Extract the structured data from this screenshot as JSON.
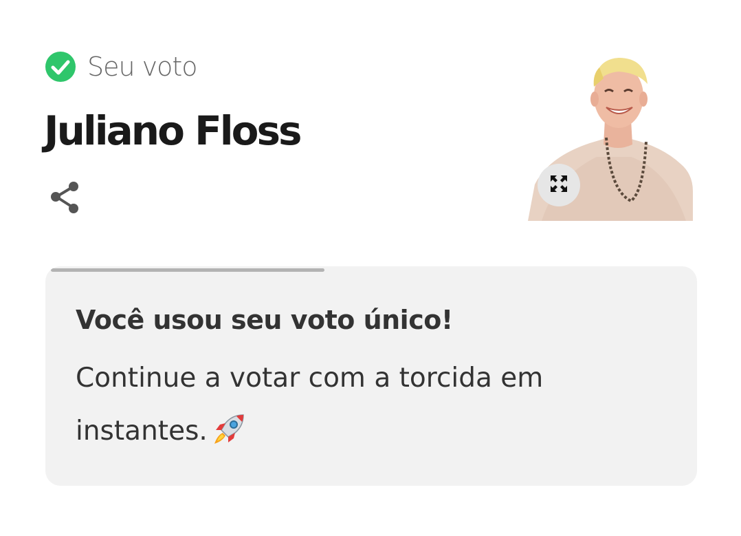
{
  "vote_status": {
    "label": "Seu voto",
    "icon": "check-circle-icon",
    "color": "#2fc66b"
  },
  "candidate": {
    "name": "Juliano Floss",
    "photo_icon": "candidate-photo"
  },
  "actions": {
    "share_icon": "share-icon",
    "expand_icon": "expand-icon"
  },
  "message": {
    "title": "Você usou seu voto único!",
    "body": "Continue a votar com a torcida em instantes.",
    "emoji_icon": "rocket-icon",
    "progress": 0.42,
    "progress_color": "#b3b3b3"
  }
}
